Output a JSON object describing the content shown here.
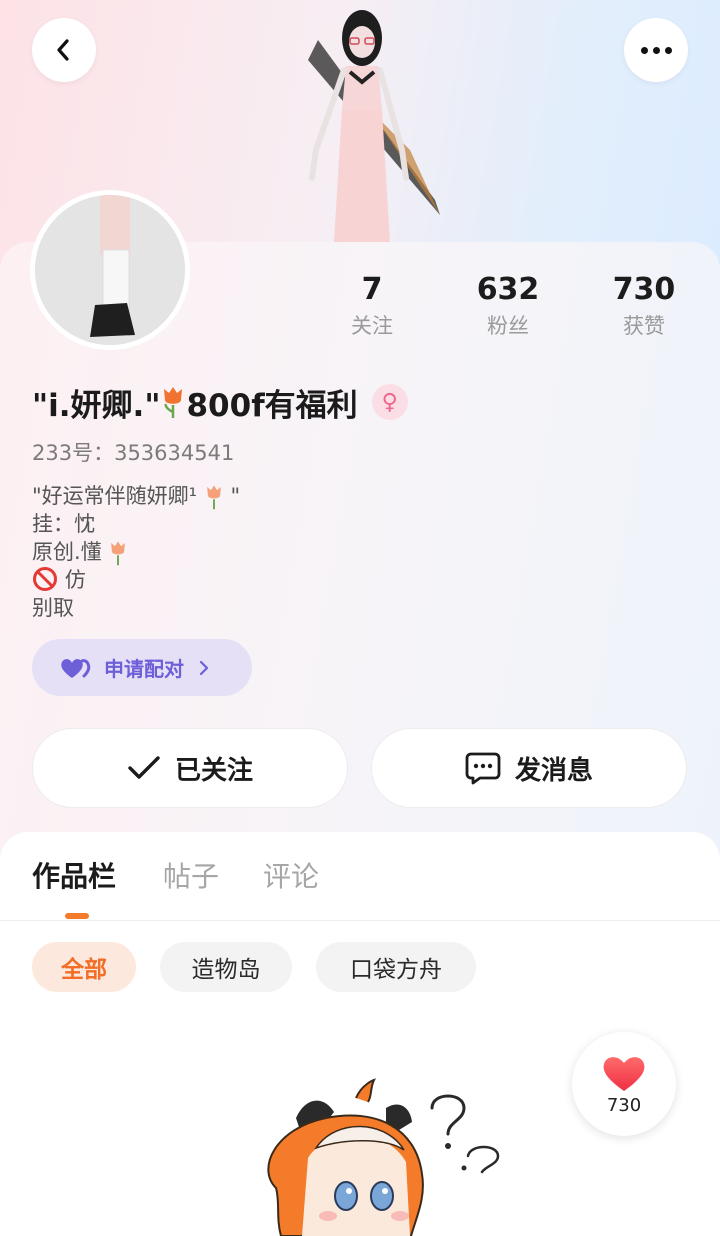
{
  "header": {
    "back_icon": "chevron-left-icon",
    "more_icon": "more-dots-icon"
  },
  "stats": [
    {
      "value": "7",
      "label": "关注"
    },
    {
      "value": "632",
      "label": "粉丝"
    },
    {
      "value": "730",
      "label": "获赞"
    }
  ],
  "profile": {
    "name_part1": "\"i.妍卿.\"",
    "name_part2": "800f有福利",
    "gender_symbol": "♀",
    "uid": "233号：353634541",
    "bio_line1": "\"好运常伴随妍卿¹",
    "bio_line1_end": "\"",
    "bio_line2": "挂：忱",
    "bio_line3": "原创.懂",
    "bio_line4": "仿",
    "bio_line5": "别取"
  },
  "pair_button": {
    "label": "申请配对"
  },
  "actions": {
    "follow_label": "已关注",
    "message_label": "发消息"
  },
  "tabs": [
    {
      "label": "作品栏",
      "active": true
    },
    {
      "label": "帖子",
      "active": false
    },
    {
      "label": "评论",
      "active": false
    }
  ],
  "filters": [
    {
      "label": "全部",
      "active": true
    },
    {
      "label": "造物岛",
      "active": false
    },
    {
      "label": "口袋方舟",
      "active": false
    }
  ],
  "like_fab": {
    "count": "730"
  },
  "colors": {
    "accent": "#f47b2a",
    "pair_purple": "#6c5fd8",
    "like_red": "#f5424a"
  }
}
